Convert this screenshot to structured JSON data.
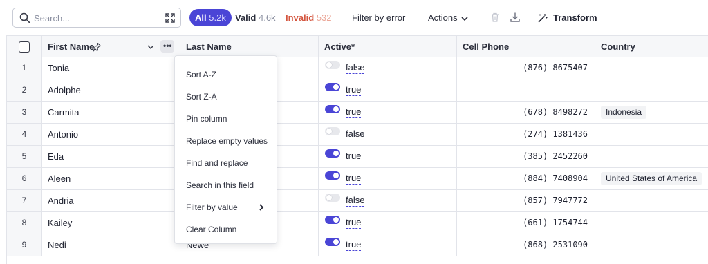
{
  "toolbar": {
    "search_placeholder": "Search...",
    "chips": [
      {
        "label": "All",
        "count": "5.2k"
      },
      {
        "label": "Valid",
        "count": "4.6k"
      },
      {
        "label": "Invalid",
        "count": "532"
      }
    ],
    "filter_label": "Filter by error",
    "actions_label": "Actions",
    "transform_label": "Transform"
  },
  "columns": {
    "first": "First Name",
    "last": "Last Name",
    "active": "Active*",
    "phone": "Cell Phone",
    "country": "Country"
  },
  "rows": [
    {
      "n": "1",
      "first": "Tonia",
      "last": "",
      "active": "false",
      "phone": "(876) 8675407",
      "country": ""
    },
    {
      "n": "2",
      "first": "Adolphe",
      "last": "",
      "active": "true",
      "phone": "",
      "country": ""
    },
    {
      "n": "3",
      "first": "Carmita",
      "last": "",
      "active": "true",
      "phone": "(678) 8498272",
      "country": "Indonesia"
    },
    {
      "n": "4",
      "first": "Antonio",
      "last": "",
      "active": "false",
      "phone": "(274) 1381436",
      "country": ""
    },
    {
      "n": "5",
      "first": "Eda",
      "last": "",
      "active": "true",
      "phone": "(385) 2452260",
      "country": ""
    },
    {
      "n": "6",
      "first": "Aleen",
      "last": "",
      "active": "true",
      "phone": "(884) 7408904",
      "country": "United States of America"
    },
    {
      "n": "7",
      "first": "Andria",
      "last": "",
      "active": "false",
      "phone": "(857) 7947772",
      "country": ""
    },
    {
      "n": "8",
      "first": "Kailey",
      "last": "",
      "active": "true",
      "phone": "(661) 1754744",
      "country": ""
    },
    {
      "n": "9",
      "first": "Nedi",
      "last": "Newe",
      "active": "true",
      "phone": "(868) 2531090",
      "country": ""
    }
  ],
  "menu": {
    "items": [
      "Sort A-Z",
      "Sort Z-A",
      "Pin column",
      "Replace empty values",
      "Find and replace",
      "Search in this field",
      "Filter by value",
      "Clear Column"
    ]
  },
  "icons": {
    "search": "search-icon",
    "expand": "expand-icon",
    "chevron": "chevron-down-icon",
    "trash": "trash-icon",
    "download": "download-icon",
    "transform": "magic-wand-icon",
    "pin": "pin-icon",
    "more": "more-horizontal-icon",
    "submenu": "chevron-right-icon"
  },
  "colors": {
    "accent": "#4a45d6",
    "invalid": "#d4553e",
    "header_bg": "#f6f7f9",
    "border": "#e2e4ea"
  }
}
